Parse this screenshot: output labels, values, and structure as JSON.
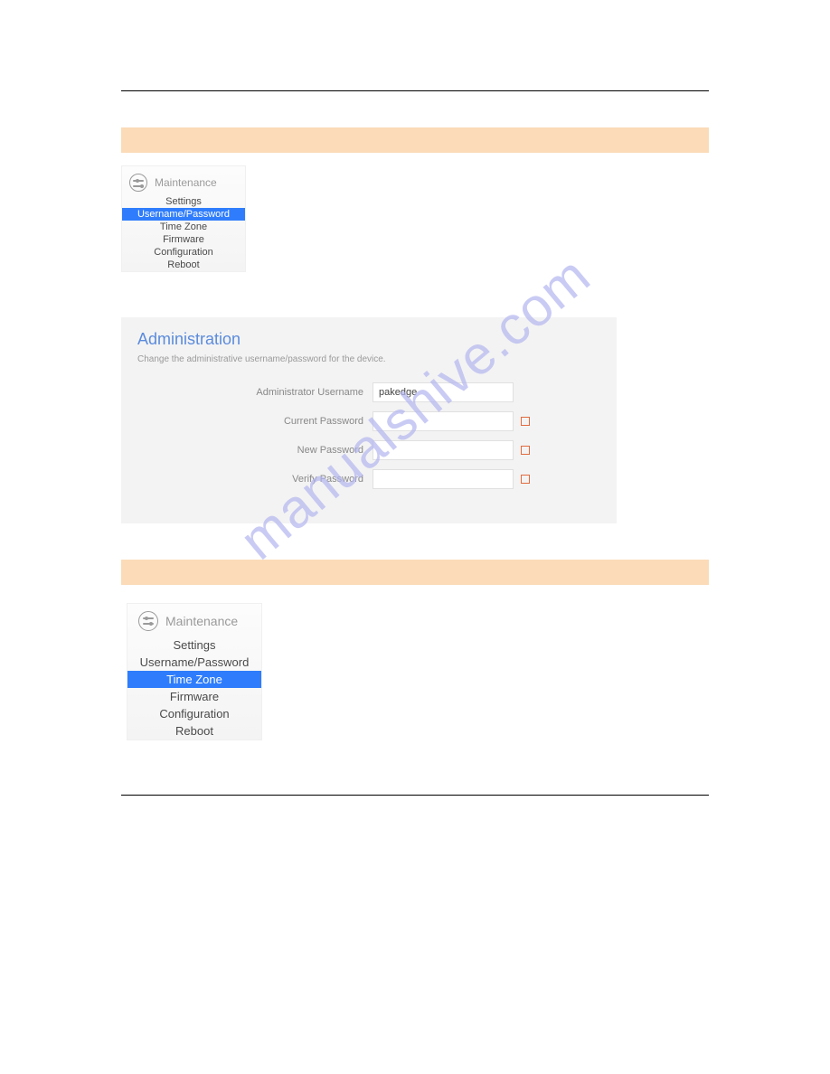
{
  "watermark": "manualshive.com",
  "maint1": {
    "title": "Maintenance",
    "items": [
      "Settings",
      "Username/Password",
      "Time Zone",
      "Firmware",
      "Configuration",
      "Reboot"
    ],
    "active_index": 1
  },
  "admin": {
    "title": "Administration",
    "desc": "Change the administrative username/password for the device.",
    "fields": {
      "admin_username_label": "Administrator Username",
      "admin_username_value": "pakedge",
      "current_password_label": "Current Password",
      "new_password_label": "New Password",
      "verify_password_label": "Verify Password"
    }
  },
  "maint2": {
    "title": "Maintenance",
    "items": [
      "Settings",
      "Username/Password",
      "Time Zone",
      "Firmware",
      "Configuration",
      "Reboot"
    ],
    "active_index": 2
  }
}
